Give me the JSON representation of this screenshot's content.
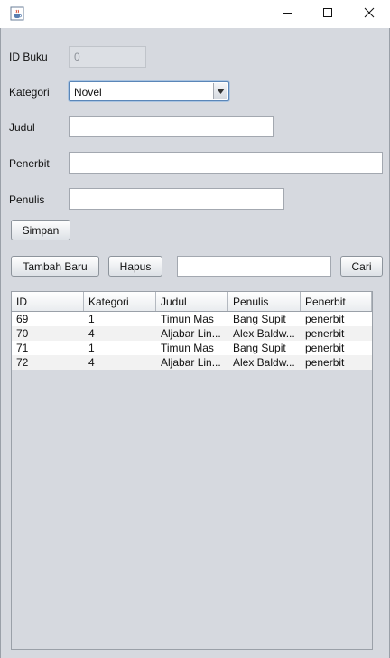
{
  "window": {
    "minimize_icon": "minimize-icon",
    "maximize_icon": "maximize-icon",
    "close_icon": "close-icon",
    "app_icon": "java-cup-icon"
  },
  "form": {
    "id_label": "ID Buku",
    "id_value": "0",
    "kategori_label": "Kategori",
    "kategori_value": "Novel",
    "judul_label": "Judul",
    "judul_value": "",
    "penerbit_label": "Penerbit",
    "penerbit_value": "",
    "penulis_label": "Penulis",
    "penulis_value": "",
    "simpan_label": "Simpan"
  },
  "toolbar": {
    "tambah_label": "Tambah Baru",
    "hapus_label": "Hapus",
    "search_value": "",
    "cari_label": "Cari"
  },
  "table": {
    "headers": [
      "ID",
      "Kategori",
      "Judul",
      "Penulis",
      "Penerbit"
    ],
    "rows": [
      [
        "69",
        "1",
        "Timun Mas",
        "Bang Supit",
        "penerbit"
      ],
      [
        "70",
        "4",
        "Aljabar Lin...",
        "Alex Baldw...",
        "penerbit"
      ],
      [
        "71",
        "1",
        "Timun Mas",
        "Bang Supit",
        "penerbit"
      ],
      [
        "72",
        "4",
        "Aljabar Lin...",
        "Alex Baldw...",
        "penerbit"
      ]
    ]
  },
  "colors": {
    "panel_bg": "#d6d9df",
    "focus_border": "#5a86b8"
  }
}
